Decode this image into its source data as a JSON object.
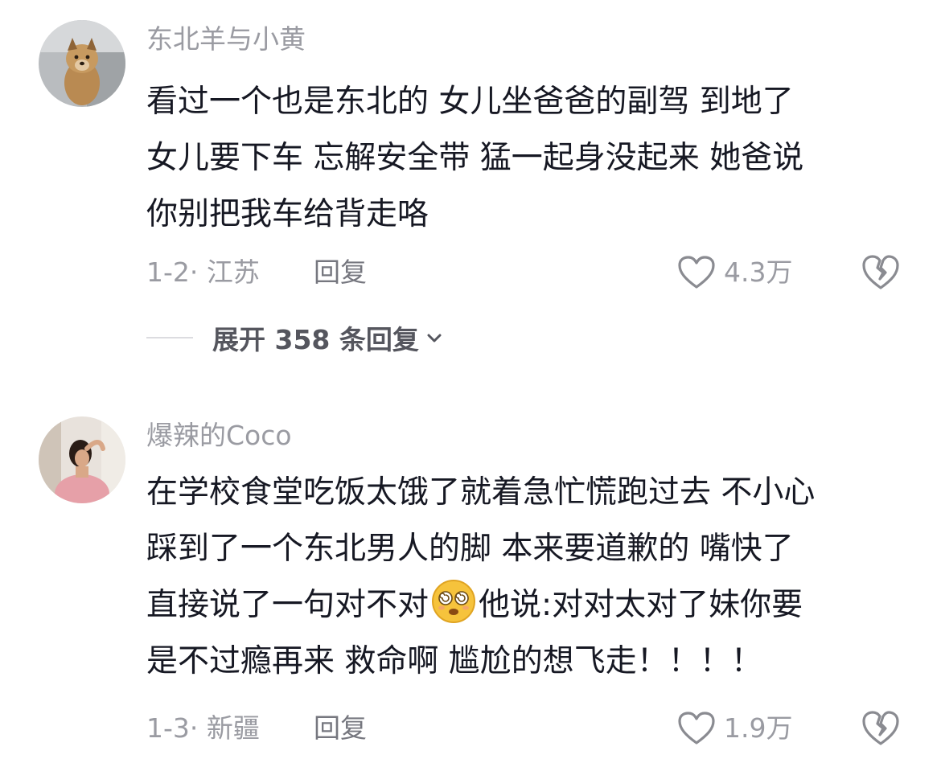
{
  "comments": [
    {
      "username": "东北羊与小黄",
      "avatar_icon": "puppy-avatar",
      "lines": [
        "看过一个也是东北的 女儿坐爸爸的副驾 到地了",
        "女儿要下车 忘解安全带 猛一起身没起来 她爸说",
        "你别把我车给背走咯"
      ],
      "date_location": "1-2· 江苏",
      "reply_label": "回复",
      "likes": "4.3万",
      "expand_label": "展开 358 条回复"
    },
    {
      "username": "爆辣的Coco",
      "avatar_icon": "woman-photo-avatar",
      "lines": [
        "在学校食堂吃饭太饿了就着急忙慌跑过去 不小心",
        "踩到了一个东北男人的脚 本来要道歉的 嘴快了"
      ],
      "line3_before": "直接说了一句对不对",
      "line3_emoji": "dizzy-face-emoji",
      "line3_after": "他说:对对太对了妹你要",
      "line4": "是不过瘾再来 救命啊 尴尬的想飞走！！！！",
      "date_location": "1-3· 新疆",
      "reply_label": "回复",
      "likes": "1.9万"
    }
  ],
  "colors": {
    "primary_text": "#161823",
    "secondary_text": "#9a9ba2",
    "icon_stroke": "#8a8b91"
  }
}
